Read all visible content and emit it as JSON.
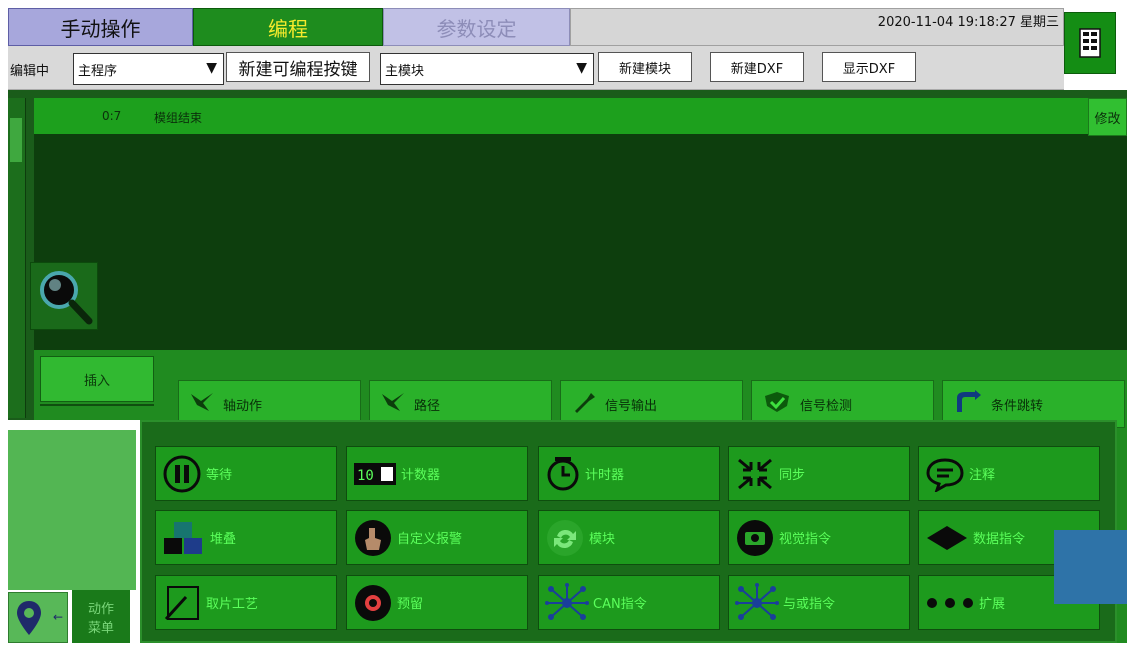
{
  "tabs": {
    "manual": "手动操作",
    "program": "编程",
    "params": "参数设定"
  },
  "status": {
    "datetime": "2020-11-04  19:18:27  星期三"
  },
  "toolbar": {
    "editing_label": "编辑中",
    "program_select": "主程序",
    "new_prog_key": "新建可编程按键",
    "module_select": "主模块",
    "new_module": "新建模块",
    "new_dxf": "新建DXF",
    "show_dxf": "显示DXF"
  },
  "program": {
    "rows": [
      {
        "num": "0:7",
        "text": "模组结束"
      }
    ],
    "edit_label": "修改"
  },
  "insert_label": "插入",
  "top_buttons": [
    {
      "label": "轴动作",
      "icon": "axis-move-icon"
    },
    {
      "label": "路径",
      "icon": "path-icon"
    },
    {
      "label": "信号输出",
      "icon": "signal-output-icon"
    },
    {
      "label": "信号检测",
      "icon": "signal-detect-icon"
    },
    {
      "label": "条件跳转",
      "icon": "condition-jump-icon"
    }
  ],
  "commands": [
    [
      {
        "label": "等待",
        "icon": "pause-icon"
      },
      {
        "label": "计数器",
        "icon": "counter-icon"
      },
      {
        "label": "计时器",
        "icon": "timer-icon"
      },
      {
        "label": "同步",
        "icon": "sync-icon"
      },
      {
        "label": "注释",
        "icon": "comment-icon"
      }
    ],
    [
      {
        "label": "堆叠",
        "icon": "stack-icon"
      },
      {
        "label": "自定义报警",
        "icon": "custom-alarm-icon"
      },
      {
        "label": "模块",
        "icon": "module-icon"
      },
      {
        "label": "视觉指令",
        "icon": "vision-icon"
      },
      {
        "label": "数据指令",
        "icon": "data-icon"
      }
    ],
    [
      {
        "label": "取片工艺",
        "icon": "pick-process-icon"
      },
      {
        "label": "预留",
        "icon": "reserve-icon"
      },
      {
        "label": "CAN指令",
        "icon": "can-icon"
      },
      {
        "label": "与或指令",
        "icon": "and-or-icon"
      },
      {
        "label": "扩展",
        "icon": "expand-icon"
      }
    ]
  ],
  "action_menu": [
    "动作",
    "菜单"
  ],
  "colors": {
    "program_tab": "#1e8c1e",
    "program_tab_text": "#f4ea2c",
    "manual_tab": "#a7a7dc",
    "row_highlight": "#1da01d",
    "command_text": "#5bff5b"
  }
}
